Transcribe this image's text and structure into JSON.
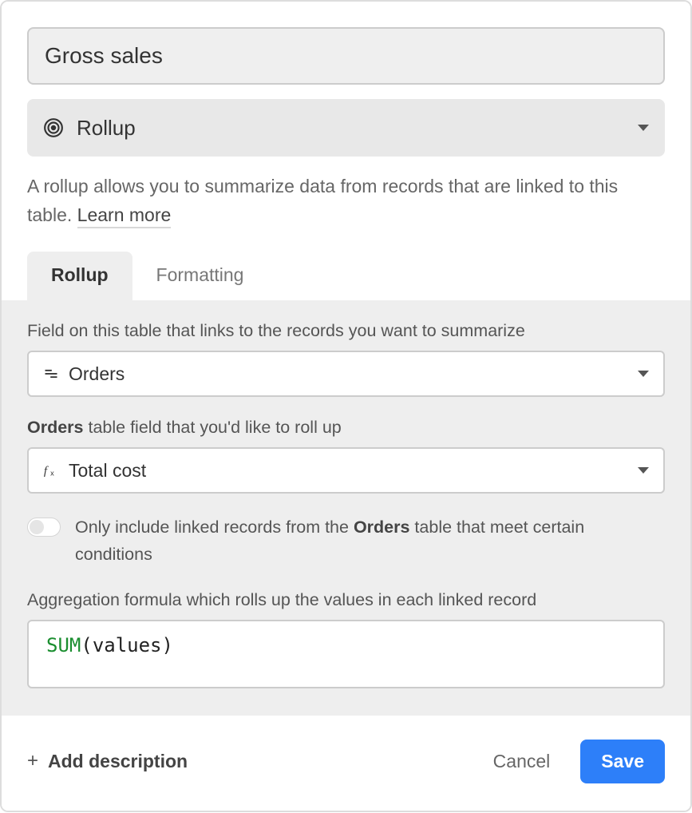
{
  "fieldName": "Gross sales",
  "fieldType": {
    "label": "Rollup"
  },
  "description": {
    "text": "A rollup allows you to summarize data from records that are linked to this table. ",
    "learnMore": "Learn more"
  },
  "tabs": {
    "rollup": "Rollup",
    "formatting": "Formatting"
  },
  "config": {
    "linkFieldLabel": "Field on this table that links to the records you want to summarize",
    "linkFieldValue": "Orders",
    "rollupFieldPrefix": "Orders",
    "rollupFieldLabelRest": " table field that you'd like to roll up",
    "rollupFieldValue": "Total cost",
    "conditionsPrefix": "Only include linked records from the ",
    "conditionsTable": "Orders",
    "conditionsSuffix": " table that meet certain conditions",
    "aggLabel": "Aggregation formula which rolls up the values in each linked record",
    "formula": {
      "fn": "SUM",
      "open": "(",
      "arg": "values",
      "close": ")"
    }
  },
  "footer": {
    "addDescription": "Add description",
    "cancel": "Cancel",
    "save": "Save"
  }
}
